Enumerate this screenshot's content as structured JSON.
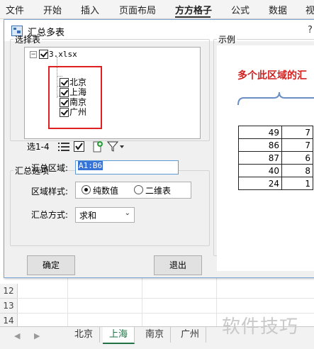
{
  "ribbon": {
    "tabs": [
      {
        "label": "文件"
      },
      {
        "label": "开始"
      },
      {
        "label": "插入"
      },
      {
        "label": "页面布局"
      },
      {
        "label": "方方格子",
        "active": true
      },
      {
        "label": "公式"
      },
      {
        "label": "数据"
      },
      {
        "label": "视"
      }
    ]
  },
  "dialog": {
    "title": "汇总多表",
    "help": "?",
    "select_group": {
      "legend": "选择表",
      "tree": {
        "root": "3.xlsx",
        "sheets": [
          "北京",
          "上海",
          "南京",
          "广州"
        ]
      },
      "selection_count": "选1-4"
    },
    "options_group": {
      "legend": "汇总选项",
      "range_label": "汇总区域:",
      "range_value": "A1:B6",
      "style_label": "区域样式:",
      "style_option_1": "纯数值",
      "style_option_2": "二维表",
      "style_selected": "纯数值",
      "method_label": "汇总方式:",
      "method_value": "求和"
    },
    "example_group": {
      "legend": "示例",
      "caption": "多个此区域的汇",
      "table": [
        [
          "49",
          "7"
        ],
        [
          "86",
          "7"
        ],
        [
          "87",
          "6"
        ],
        [
          "40",
          "8"
        ],
        [
          "24",
          "1"
        ]
      ]
    },
    "ok_button": "确定",
    "exit_button": "退出"
  },
  "sheet": {
    "rows": [
      "12",
      "13",
      "14"
    ],
    "tabs": [
      "北京",
      "上海",
      "南京",
      "广州"
    ],
    "active_tab": "上海"
  },
  "watermark": "软件技巧",
  "colors": {
    "highlight_box": "#e02020",
    "caption": "#d02020",
    "active_sheet_tab": "#217346"
  }
}
